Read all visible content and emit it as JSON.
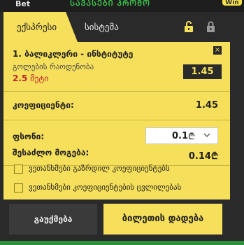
{
  "topbar": {
    "bet_tab": "Bet",
    "marquee": "ᲡᲐᲕᲐᲡᲔᲑᲘ ᲞᲠᲝᲛᲝ",
    "win_badge": "Win"
  },
  "slip": {
    "tabs": {
      "express": "ექსპრესი",
      "system": "სისტემა"
    },
    "bet": {
      "event": "1. ბალიკლერი - ინსტიტუტე",
      "market": "გოლების რაოდენობა",
      "selection_value": "2.5",
      "selection_label": "მეტი",
      "odds": "1.45",
      "close": "×"
    },
    "coefficient": {
      "label": "კოეფიციენტი:",
      "value": "1.45"
    },
    "stake": {
      "label": "ფსონი:",
      "value": "0.1",
      "currency": "₾"
    },
    "possible_win": {
      "label": "შესაძლო მოგება:",
      "value": "0.14₾"
    },
    "options": [
      "ვეთანხმები გაზრდილ კოეფიციენტებს",
      "ვეთანხმები კოეფიციენტების ცვლილებას"
    ],
    "buttons": {
      "cancel": "გაუქმება",
      "place": "ბილეთის დადება"
    }
  },
  "colors": {
    "accent_yellow": "#f6df5a",
    "dark": "#2a2a2a",
    "selection_red": "#c0262d",
    "marquee_green": "#3ec04a"
  }
}
